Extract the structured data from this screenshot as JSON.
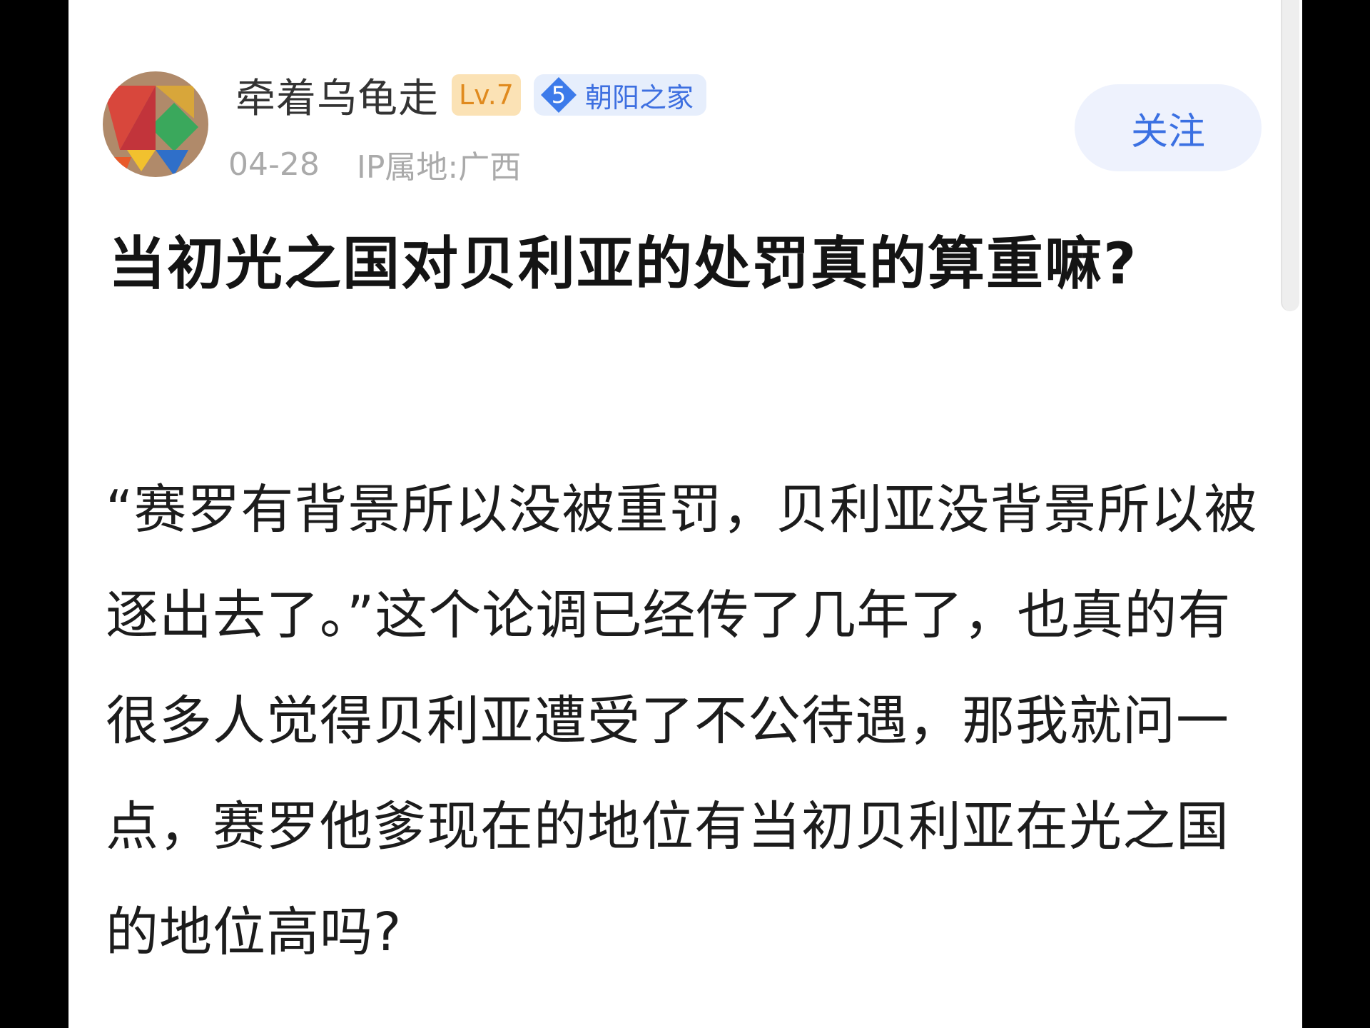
{
  "post": {
    "author": {
      "name": "牵着乌龟走",
      "level": "Lv.7",
      "forum_level": "5",
      "forum_name": "朝阳之家"
    },
    "date": "04-28",
    "ip_location": "IP属地:广西",
    "follow_label": "关注",
    "title": "当初光之国对贝利亚的处罚真的算重嘛?",
    "body": "“赛罗有背景所以没被重罚，贝利亚没背景所以被逐出去了。”这个论调已经传了几年了，也真的有很多人觉得贝利亚遭受了不公待遇，那我就问一点，赛罗他爹现在的地位有当初贝利亚在光之国的地位高吗?"
  },
  "colors": {
    "accent_blue": "#3a70e2",
    "follow_bg": "#eef2fd",
    "level_badge_bg": "#fbe2b5",
    "level_badge_text": "#e08a1e",
    "forum_badge_bg": "#e6eefc",
    "meta_gray": "#aaaaaa",
    "title_text": "#141414",
    "body_text": "#1c1c1c"
  },
  "icons": {
    "avatar": "colorful-tangram-avatar",
    "forum_level": "blue-diamond-level-icon"
  }
}
